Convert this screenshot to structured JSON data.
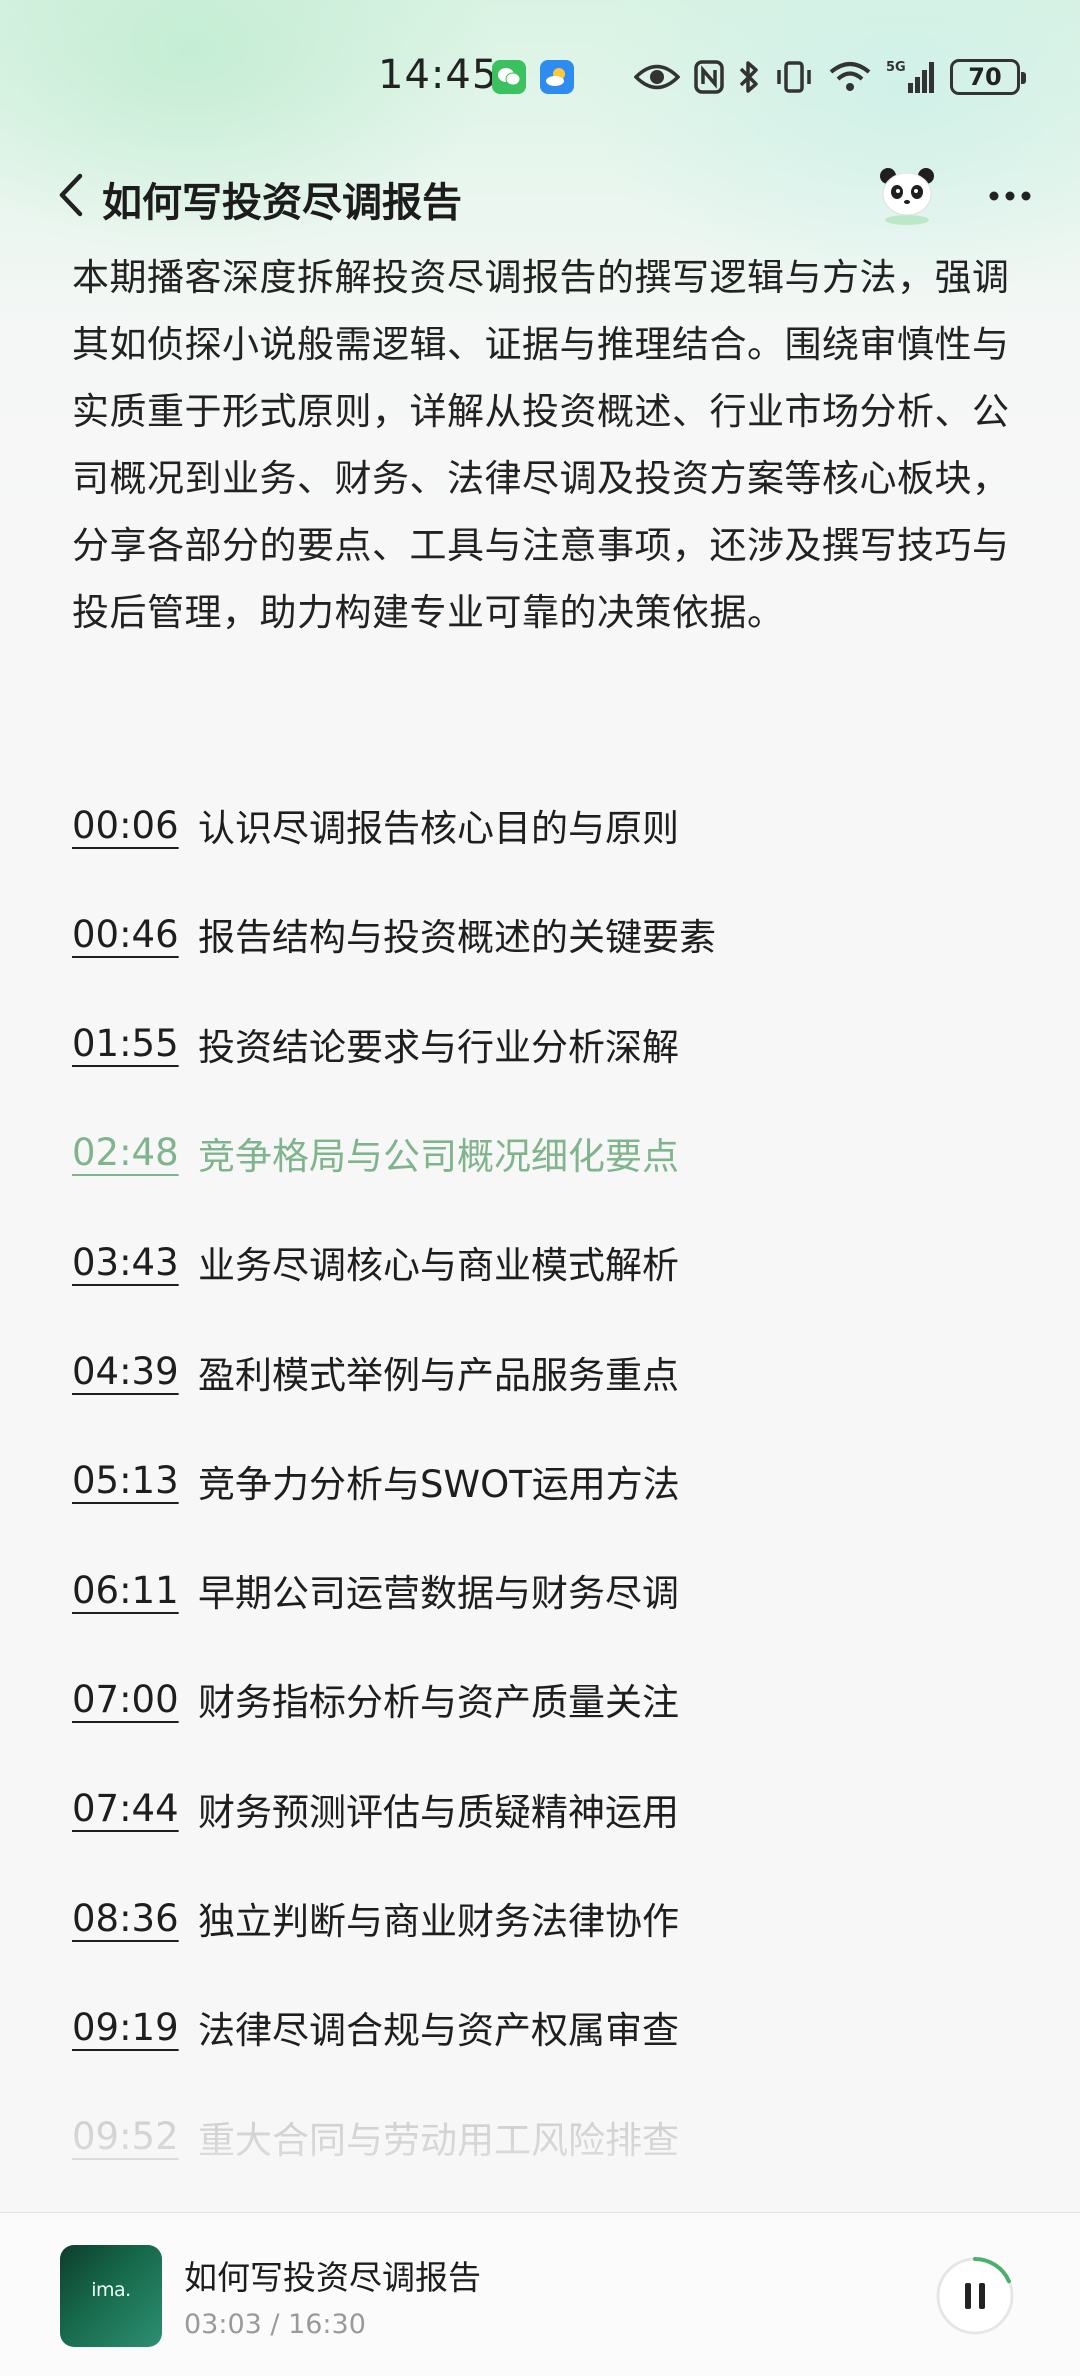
{
  "status_bar": {
    "time": "14:45",
    "network": "5G",
    "battery": "70",
    "icons": [
      "wechat-icon",
      "weather-icon",
      "eye-icon",
      "nfc-icon",
      "bluetooth-icon",
      "vibrate-icon",
      "wifi-icon",
      "signal-icon",
      "battery-icon"
    ]
  },
  "header": {
    "title": "如何写投资尽调报告",
    "back_icon": "chevron-left-icon",
    "avatar_icon": "panda-avatar",
    "more_icon": "more-dots-icon"
  },
  "description": "本期播客深度拆解投资尽调报告的撰写逻辑与方法，强调其如侦探小说般需逻辑、证据与推理结合。围绕审慎性与实质重于形式原则，详解从投资概述、行业市场分析、公司概况到业务、财务、法律尽调及投资方案等核心板块，分享各部分的要点、工具与注意事项，还涉及撰写技巧与投后管理，助力构建专业可靠的决策依据。",
  "chapters": [
    {
      "time": "00:06",
      "title": "认识尽调报告核心目的与原则",
      "state": "normal"
    },
    {
      "time": "00:46",
      "title": "报告结构与投资概述的关键要素",
      "state": "normal"
    },
    {
      "time": "01:55",
      "title": "投资结论要求与行业分析深解",
      "state": "normal"
    },
    {
      "time": "02:48",
      "title": "竞争格局与公司概况细化要点",
      "state": "active"
    },
    {
      "time": "03:43",
      "title": "业务尽调核心与商业模式解析",
      "state": "normal"
    },
    {
      "time": "04:39",
      "title": "盈利模式举例与产品服务重点",
      "state": "normal"
    },
    {
      "time": "05:13",
      "title": "竞争力分析与SWOT运用方法",
      "state": "normal"
    },
    {
      "time": "06:11",
      "title": "早期公司运营数据与财务尽调",
      "state": "normal"
    },
    {
      "time": "07:00",
      "title": "财务指标分析与资产质量关注",
      "state": "normal"
    },
    {
      "time": "07:44",
      "title": "财务预测评估与质疑精神运用",
      "state": "normal"
    },
    {
      "time": "08:36",
      "title": "独立判断与商业财务法律协作",
      "state": "normal"
    },
    {
      "time": "09:19",
      "title": "法律尽调合规与资产权属审查",
      "state": "normal"
    },
    {
      "time": "09:52",
      "title": "重大合同与劳动用工风险排查",
      "state": "faded"
    }
  ],
  "player": {
    "title": "如何写投资尽调报告",
    "current_time": "03:03",
    "separator": "/",
    "duration": "16:30",
    "time_display": "03:03 / 16:30",
    "cover_text": "ima.",
    "progress_fraction": 0.185,
    "accent_color": "#4caf6e",
    "play_state_icon": "pause-icon"
  },
  "colors": {
    "active_chapter": "#7fb48c",
    "text": "#1e1e1e",
    "faded": "#c8c8c8"
  }
}
